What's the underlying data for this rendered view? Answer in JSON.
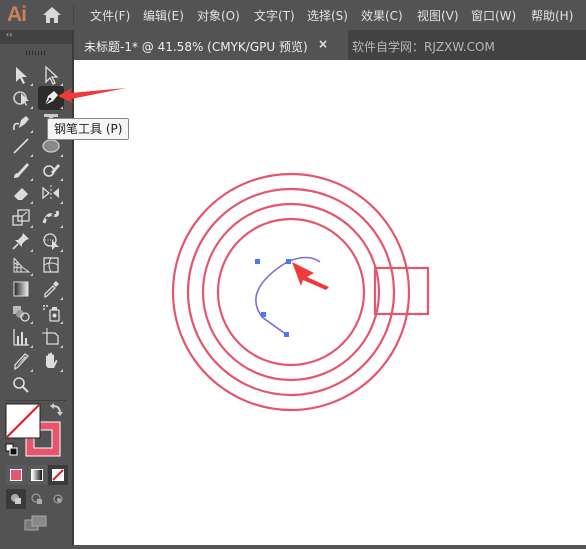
{
  "app": {
    "logo": "Ai"
  },
  "menu": [
    {
      "label": "文件(F)"
    },
    {
      "label": "编辑(E)"
    },
    {
      "label": "对象(O)"
    },
    {
      "label": "文字(T)"
    },
    {
      "label": "选择(S)"
    },
    {
      "label": "效果(C)"
    },
    {
      "label": "视图(V)"
    },
    {
      "label": "窗口(W)"
    },
    {
      "label": "帮助(H)"
    }
  ],
  "tabs": {
    "active": {
      "title": "未标题-1* @ 41.58% (CMYK/GPU 预览)",
      "close": "×"
    },
    "inactive": {
      "title": "软件自学网：RJZXW.COM"
    }
  },
  "toolbar": {
    "collapse_label": "‹‹",
    "tools": [
      {
        "name": "selection-tool",
        "icon": "selection-icon"
      },
      {
        "name": "direct-selection-tool",
        "icon": "direct-selection-icon"
      },
      {
        "name": "magic-wand-tool",
        "icon": "magic-wand-icon"
      },
      {
        "name": "pen-tool",
        "icon": "pen-icon",
        "active": true
      },
      {
        "name": "curvature-tool",
        "icon": "curvature-icon"
      },
      {
        "name": "type-tool",
        "icon": "type-icon"
      },
      {
        "name": "line-tool",
        "icon": "line-icon"
      },
      {
        "name": "ellipse-tool",
        "icon": "ellipse-icon"
      },
      {
        "name": "paintbrush-tool",
        "icon": "paintbrush-icon"
      },
      {
        "name": "shaper-tool",
        "icon": "shaper-icon"
      },
      {
        "name": "eraser-tool",
        "icon": "eraser-icon"
      },
      {
        "name": "reflect-tool",
        "icon": "reflect-icon"
      },
      {
        "name": "scale-tool",
        "icon": "scale-icon"
      },
      {
        "name": "puppet-warp-tool",
        "icon": "puppet-warp-icon"
      },
      {
        "name": "pin-tool",
        "icon": "pin-icon"
      },
      {
        "name": "shape-builder-tool",
        "icon": "shape-builder-icon"
      },
      {
        "name": "perspective-grid-tool",
        "icon": "perspective-grid-icon"
      },
      {
        "name": "mesh-tool",
        "icon": "mesh-icon"
      },
      {
        "name": "gradient-tool",
        "icon": "gradient-icon"
      },
      {
        "name": "eyedropper-tool",
        "icon": "eyedropper-icon"
      },
      {
        "name": "blend-tool",
        "icon": "blend-icon"
      },
      {
        "name": "symbol-sprayer-tool",
        "icon": "symbol-sprayer-icon"
      },
      {
        "name": "graph-tool",
        "icon": "column-graph-icon"
      },
      {
        "name": "artboard-tool",
        "icon": "artboard-icon"
      },
      {
        "name": "slice-tool",
        "icon": "slice-icon"
      },
      {
        "name": "hand-tool",
        "icon": "hand-icon"
      },
      {
        "name": "zoom-tool",
        "icon": "zoom-icon"
      }
    ],
    "tooltip": "钢笔工具 (P)"
  },
  "colors": {
    "fill": "none",
    "stroke": "#e5566e",
    "accent_stroke": "#e05a72",
    "path": "#7b6fd0",
    "anchor": "#4a7af0",
    "arrow": "#f03a3a"
  },
  "canvas": {
    "description": "Four concentric red circles, a red rectangle on the right, and an in-progress blue pen path with anchor points"
  }
}
